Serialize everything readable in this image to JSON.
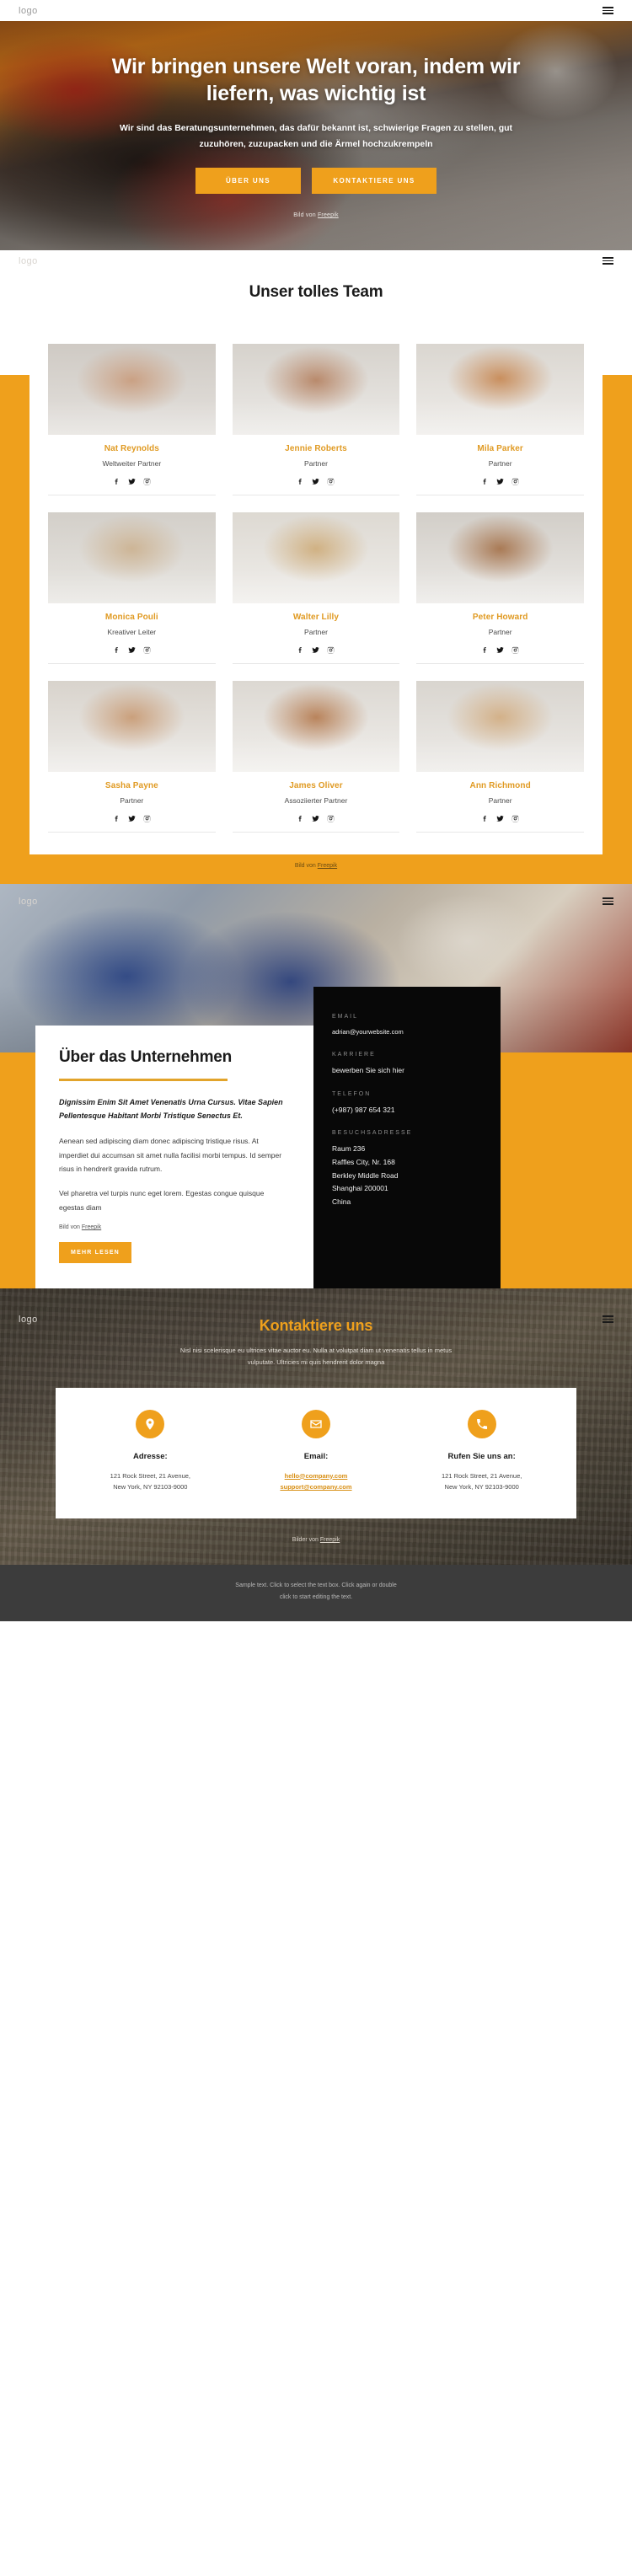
{
  "brand": {
    "logo": "logo"
  },
  "nav": {
    "menu_icon": "hamburger-icon"
  },
  "hero": {
    "heading": "Wir bringen unsere Welt voran, indem wir liefern, was wichtig ist",
    "subheading": "Wir sind das Beratungsunternehmen, das dafür bekannt ist, schwierige Fragen zu stellen, gut zuzuhören, zuzupacken und die Ärmel hochzukrempeln",
    "btn_primary": "ÜBER UNS",
    "btn_secondary": "KONTAKTIERE UNS",
    "credit_prefix": "Bild von ",
    "credit_link": "Freepik"
  },
  "team": {
    "title": "Unser tolles Team",
    "credit_prefix": "Bild von ",
    "credit_link": "Freepik",
    "members": [
      {
        "name": "Nat Reynolds",
        "role": "Weltweiter Partner"
      },
      {
        "name": "Jennie Roberts",
        "role": "Partner"
      },
      {
        "name": "Mila Parker",
        "role": "Partner"
      },
      {
        "name": "Monica Pouli",
        "role": "Kreativer Leiter"
      },
      {
        "name": "Walter Lilly",
        "role": "Partner"
      },
      {
        "name": "Peter Howard",
        "role": "Partner"
      },
      {
        "name": "Sasha Payne",
        "role": "Partner"
      },
      {
        "name": "James Oliver",
        "role": "Assoziierter Partner"
      },
      {
        "name": "Ann Richmond",
        "role": "Partner"
      }
    ]
  },
  "about": {
    "title": "Über das Unternehmen",
    "lead": "Dignissim Enim Sit Amet Venenatis Urna Cursus. Vitae Sapien Pellentesque Habitant Morbi Tristique Senectus Et.",
    "paragraph1": "Aenean sed adipiscing diam donec adipiscing tristique risus. At imperdiet dui accumsan sit amet nulla facilisi morbi tempus. Id semper risus in hendrerit gravida rutrum.",
    "paragraph2": "Vel pharetra vel turpis nunc eget lorem. Egestas congue quisque egestas diam",
    "credit_prefix": "Bild von ",
    "credit_link": "Freepik",
    "button": "MEHR LESEN",
    "contact": {
      "email_label": "EMAIL",
      "email_value": "adrian@yourwebsite.com",
      "career_label": "KARRIERE",
      "career_value": "bewerben Sie sich hier",
      "phone_label": "TELEFON",
      "phone_value": "(+987) 987 654 321",
      "address_label": "BESUCHSADRESSE",
      "address_value": "Raum 236\nRaffles City, Nr. 168\nBerkley Middle Road\nShanghai 200001\nChina"
    }
  },
  "contact_section": {
    "title": "Kontaktiere uns",
    "subtitle": "Nisl nisi scelerisque eu ultrices vitae auctor eu. Nulla at volutpat diam ut venenatis tellus in metus vulputate. Ultricies mi quis hendrerit dolor magna",
    "cards": [
      {
        "icon": "location-pin-icon",
        "title": "Adresse:",
        "lines": [
          "121 Rock Street, 21 Avenue,",
          "New York, NY 92103-9000"
        ],
        "links": []
      },
      {
        "icon": "envelope-icon",
        "title": "Email:",
        "lines": [],
        "links": [
          "hello@company.com",
          "support@company.com"
        ]
      },
      {
        "icon": "phone-icon",
        "title": "Rufen Sie uns an:",
        "lines": [
          "121 Rock Street, 21 Avenue,",
          "New York, NY 92103-9000"
        ],
        "links": []
      }
    ],
    "credit_prefix": "Bilder von ",
    "credit_link": "Freepik"
  },
  "footer": {
    "line1": "Sample text. Click to select the text box. Click again or double",
    "line2": "click to start editing the text."
  },
  "colors": {
    "accent": "#efa01c",
    "name": "#e09a22",
    "dark": "#080808"
  }
}
